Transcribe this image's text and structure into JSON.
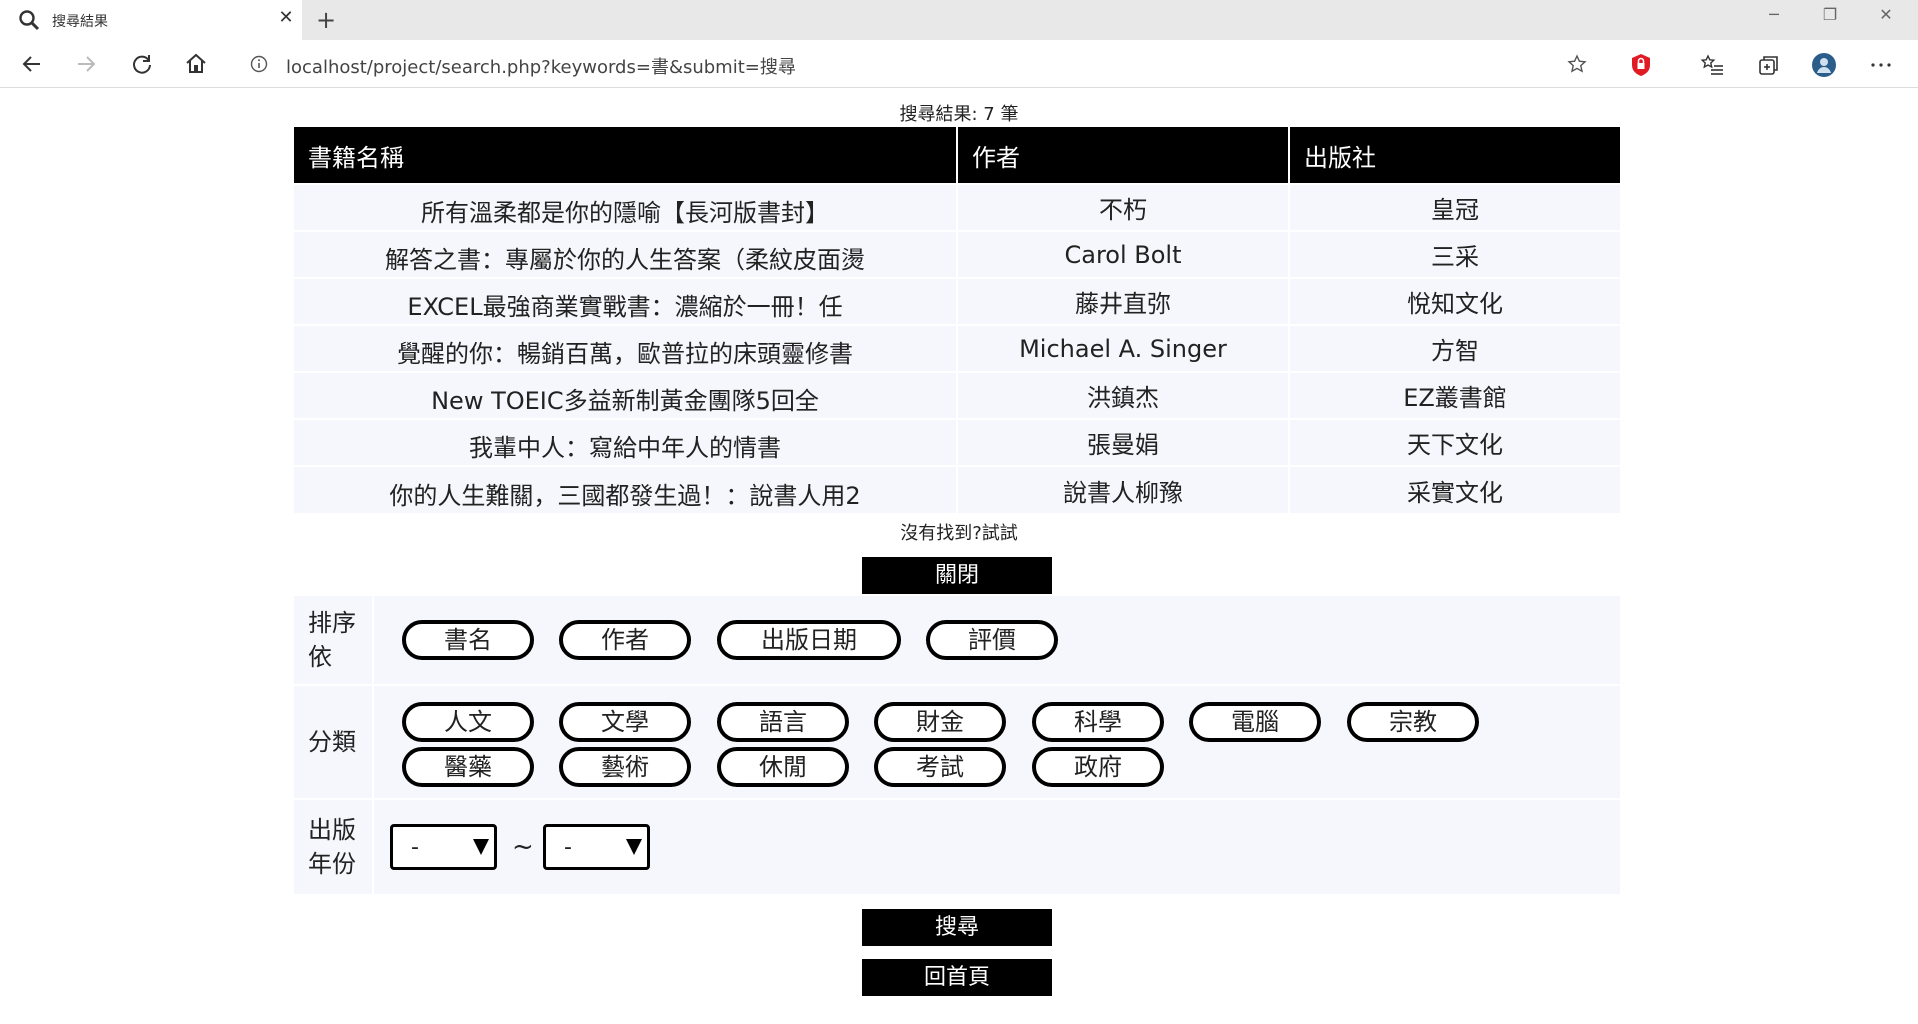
{
  "browser": {
    "tab_title": "搜尋結果",
    "tab_close": "✕",
    "new_tab": "+",
    "url": "localhost/project/search.php?keywords=書&submit=搜尋",
    "window_controls": {
      "minimize": "─",
      "maximize": "❐",
      "close": "✕"
    }
  },
  "results": {
    "count_text": "搜尋結果: 7 筆",
    "headers": [
      "書籍名稱",
      "作者",
      "出版社"
    ],
    "rows": [
      {
        "title": "所有溫柔都是你的隱喻【長河版書封】",
        "author": "不朽",
        "publisher": "皇冠"
      },
      {
        "title": "解答之書：專屬於你的人生答案（柔紋皮面燙",
        "author": "Carol Bolt",
        "publisher": "三采"
      },
      {
        "title": "EXCEL最強商業實戰書：濃縮於一冊！任",
        "author": "藤井直弥",
        "publisher": "悅知文化"
      },
      {
        "title": "覺醒的你：暢銷百萬，歐普拉的床頭靈修書",
        "author": "Michael A. Singer",
        "publisher": "方智"
      },
      {
        "title": "New TOEIC多益新制黃金團隊5回全",
        "author": "洪鎮杰",
        "publisher": "EZ叢書館"
      },
      {
        "title": "我輩中人：寫給中年人的情書",
        "author": "張曼娟",
        "publisher": "天下文化"
      },
      {
        "title": "你的人生難關，三國都發生過！：說書人用2",
        "author": "說書人柳豫",
        "publisher": "采實文化"
      }
    ]
  },
  "not_found_text": "沒有找到?試試",
  "close_button": "關閉",
  "sort": {
    "label": "排序依",
    "options": [
      "書名",
      "作者",
      "出版日期",
      "評價"
    ]
  },
  "category": {
    "label": "分類",
    "options": [
      "人文",
      "文學",
      "語言",
      "財金",
      "科學",
      "電腦",
      "宗教",
      "醫藥",
      "藝術",
      "休閒",
      "考試",
      "政府"
    ]
  },
  "year": {
    "label": "出版年份",
    "from_value": "-",
    "to_value": "-",
    "separator": "~"
  },
  "search_button": "搜尋",
  "home_button": "回首頁"
}
